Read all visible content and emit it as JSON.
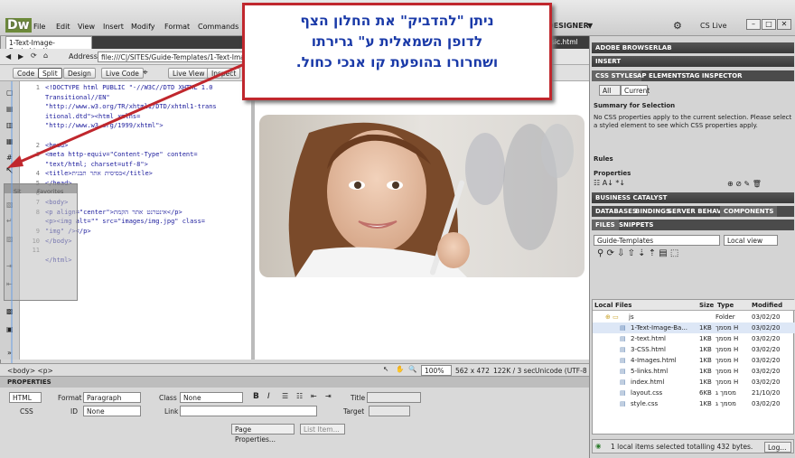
{
  "app": {
    "logo": "Dw",
    "menus": [
      "File",
      "Edit",
      "View",
      "Insert",
      "Modify",
      "Format",
      "Commands",
      "Si"
    ],
    "workspace": "DESIGNER",
    "cslive": "CS Live",
    "win_min": "–",
    "win_max": "□",
    "win_close": "✕"
  },
  "doc": {
    "tab": "1-Text-Image-Basic.html*",
    "tab_right": "sic.html",
    "address_label": "Address:",
    "address": "file:///C|/SITES/Guide-Templates/1-Text-Image-B"
  },
  "toolbar": {
    "code": "Code",
    "split": "Split",
    "design": "Design",
    "live_code": "Live Code",
    "live_view": "Live View",
    "inspect": "Inspect"
  },
  "code": {
    "lines": [
      "1",
      "",
      "",
      "",
      "",
      "",
      "2",
      "3",
      "",
      "4",
      "5",
      "6",
      "7",
      "8",
      "",
      "9",
      "10",
      "11",
      "",
      "",
      "",
      "",
      "",
      "",
      "",
      "",
      ""
    ],
    "text": "<!DOCTYPE html PUBLIC \"-//W3C//DTD XHTML 1.0\nTransitional//EN\"\n\"http://www.w3.org/TR/xhtml1/DTD/xhtml1-trans\nitional.dtd\"><html xmlns=\n\"http://www.w3.org/1999/xhtml\">\n\n<head>\n<meta http-equiv=\"Content-Type\" content=\n\"text/html; charset=utf-8\">\n<title>בסיסית אתר תבנית</title>\n</head>\n\n<body>\n<p align=\"center\">אינטרנט אתר הקמת</p>\n<p><img alt=\"\" src=\"images/img.jpg\" class=\n\"img\" /></p>\n</body>\n\n</html>"
  },
  "gutter": {
    "sit_label": "Sit",
    "favorites": "Favorites"
  },
  "status": {
    "tags": "<body> <p>",
    "zoom": "100%",
    "dims": "562 x 472",
    "size": "122K / 3 sec",
    "encoding": "Unicode (UTF-8"
  },
  "properties": {
    "title": "PROPERTIES",
    "html": "HTML",
    "css": "CSS",
    "format_label": "Format",
    "format_value": "Paragraph",
    "class_label": "Class",
    "class_value": "None",
    "id_label": "ID",
    "id_value": "None",
    "link_label": "Link",
    "title_label": "Title",
    "target_label": "Target",
    "bold": "B",
    "italic": "I",
    "page_props": "Page Properties...",
    "list_item": "List Item..."
  },
  "panels": {
    "browserlab": "ADOBE BROWSERLAB",
    "insert": "INSERT",
    "tabs_css": [
      "CSS STYLES",
      "AP ELEMENTS",
      "TAG INSPECTOR"
    ],
    "all": "All",
    "current": "Current",
    "summary": "Summary for Selection",
    "summary_text": "No CSS properties apply to the current selection.  Please select a styled element to see which CSS properties apply.",
    "rules": "Rules",
    "properties": "Properties",
    "business": "BUSINESS CATALYST",
    "tabs_db": [
      "DATABASES",
      "BINDINGS",
      "SERVER BEHAVIOR",
      "COMPONENTS"
    ],
    "tabs_files": [
      "FILES",
      "SNIPPETS"
    ],
    "site": "Guide-Templates",
    "view": "Local view",
    "col_local": "Local Files",
    "col_size": "Size",
    "col_type": "Type",
    "col_mod": "Modified",
    "status_text": "1 local items selected totalling 432 bytes.",
    "log": "Log..."
  },
  "files": [
    {
      "name": "js",
      "size": "",
      "type": "Folder",
      "mod": "03/02/20",
      "folder": true
    },
    {
      "name": "1-Text-Image-Ba...",
      "size": "1KB",
      "type": "מסמך H",
      "mod": "03/02/20"
    },
    {
      "name": "2-text.html",
      "size": "1KB",
      "type": "מסמך H",
      "mod": "03/02/20"
    },
    {
      "name": "3-CSS.html",
      "size": "1KB",
      "type": "מסמך H",
      "mod": "03/02/20"
    },
    {
      "name": "4-Images.html",
      "size": "1KB",
      "type": "מסמך H",
      "mod": "03/02/20"
    },
    {
      "name": "5-links.html",
      "size": "1KB",
      "type": "מסמך H",
      "mod": "03/02/20"
    },
    {
      "name": "index.html",
      "size": "1KB",
      "type": "מסמך H",
      "mod": "03/02/20"
    },
    {
      "name": "layout.css",
      "size": "6KB",
      "type": "מסמך ג",
      "mod": "21/10/20"
    },
    {
      "name": "style.css",
      "size": "1KB",
      "type": "מסמך ג",
      "mod": "03/02/20"
    }
  ],
  "annotation": {
    "line1": "ניתן \"להדביק\" את החלון הצף",
    "line2": "לדופן השמאלית ע\" גרירתו",
    "line3": "ושחרורו בהופעת קו אנכי כחול."
  },
  "colors": {
    "annotation_border": "#c0272d",
    "annotation_text": "#1a3aa8",
    "panel_header": "#3a3a3a"
  }
}
